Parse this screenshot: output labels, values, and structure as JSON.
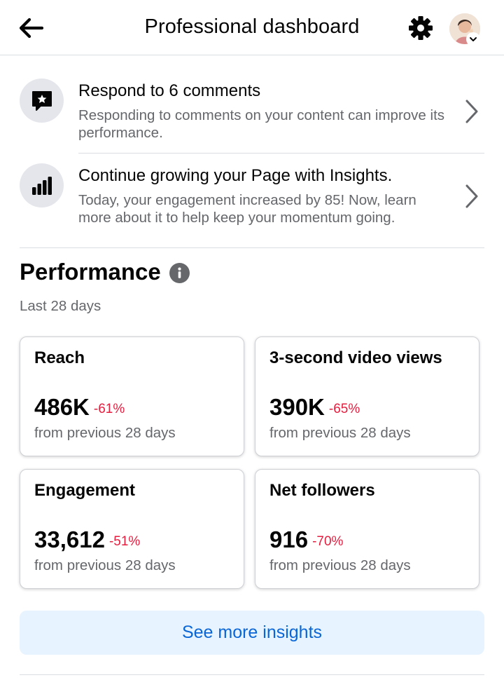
{
  "header": {
    "title": "Professional dashboard",
    "back_icon": "arrow-left-icon",
    "settings_icon": "gear-icon",
    "avatar_icon": "profile-avatar"
  },
  "tasks": [
    {
      "icon": "comment-star-icon",
      "title": "Respond to 6 comments",
      "description": "Responding to comments on your content can improve its performance."
    },
    {
      "icon": "bar-chart-icon",
      "title": "Continue growing your Page with Insights.",
      "description": "Today, your engagement increased by 85! Now, learn more about it to help keep your momentum going."
    }
  ],
  "performance": {
    "title": "Performance",
    "subtitle": "Last 28 days",
    "cards": [
      {
        "label": "Reach",
        "value": "486K",
        "change": "-61%",
        "note": "from previous 28 days"
      },
      {
        "label": "3-second video views",
        "value": "390K",
        "change": "-65%",
        "note": "from previous 28 days"
      },
      {
        "label": "Engagement",
        "value": "33,612",
        "change": "-51%",
        "note": "from previous 28 days"
      },
      {
        "label": "Net followers",
        "value": "916",
        "change": "-70%",
        "note": "from previous 28 days"
      }
    ],
    "button_label": "See more insights"
  },
  "colors": {
    "negative_change": "#e41e3f",
    "button_bg": "#e7f3ff",
    "button_text": "#0a66d6",
    "secondary_text": "#65676b"
  }
}
